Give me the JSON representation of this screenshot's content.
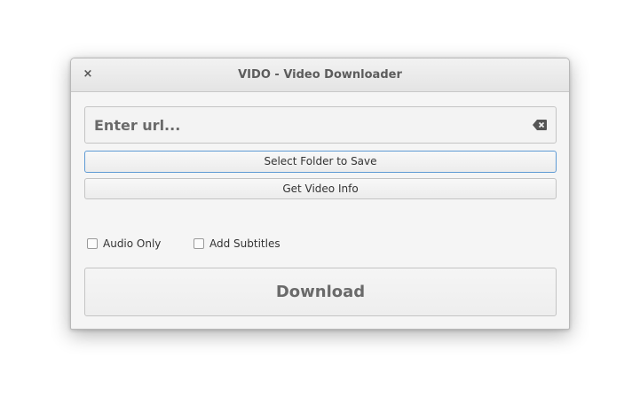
{
  "window": {
    "title": "VIDO - Video Downloader",
    "close_symbol": "×"
  },
  "url_entry": {
    "placeholder": "Enter url...",
    "value": "",
    "clear_icon": "edit-clear-icon"
  },
  "buttons": {
    "select_folder": "Select Folder to Save",
    "get_info": "Get Video Info",
    "download": "Download"
  },
  "options": {
    "audio_only": {
      "label": "Audio Only",
      "checked": false
    },
    "add_subtitles": {
      "label": "Add Subtitles",
      "checked": false
    }
  },
  "colors": {
    "focus_border": "#5e9ad4",
    "window_bg": "#f5f5f5"
  }
}
